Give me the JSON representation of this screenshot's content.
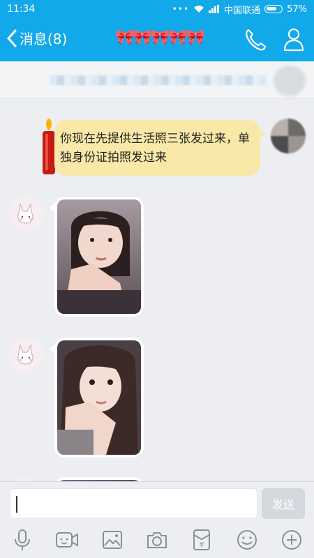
{
  "status": {
    "time": "11:34",
    "carrier": "中国联通",
    "battery": "57%"
  },
  "header": {
    "back_label": "消息(8)",
    "title_emoji": "🎀🎀🎀🎀🎀"
  },
  "messages": [
    {
      "from": "me",
      "text": "你现在先提供生活照三张发过来，单独身份证拍照发过来"
    },
    {
      "from": "other",
      "type": "photo"
    },
    {
      "from": "other",
      "type": "photo"
    }
  ],
  "input": {
    "value": "",
    "send_label": "发送"
  },
  "toolbar": [
    "mic-icon",
    "video-icon",
    "image-icon",
    "camera-icon",
    "red-packet-icon",
    "emoji-icon",
    "plus-icon"
  ],
  "colors": {
    "accent": "#12a9ea",
    "bubble": "#f8e9a8"
  }
}
